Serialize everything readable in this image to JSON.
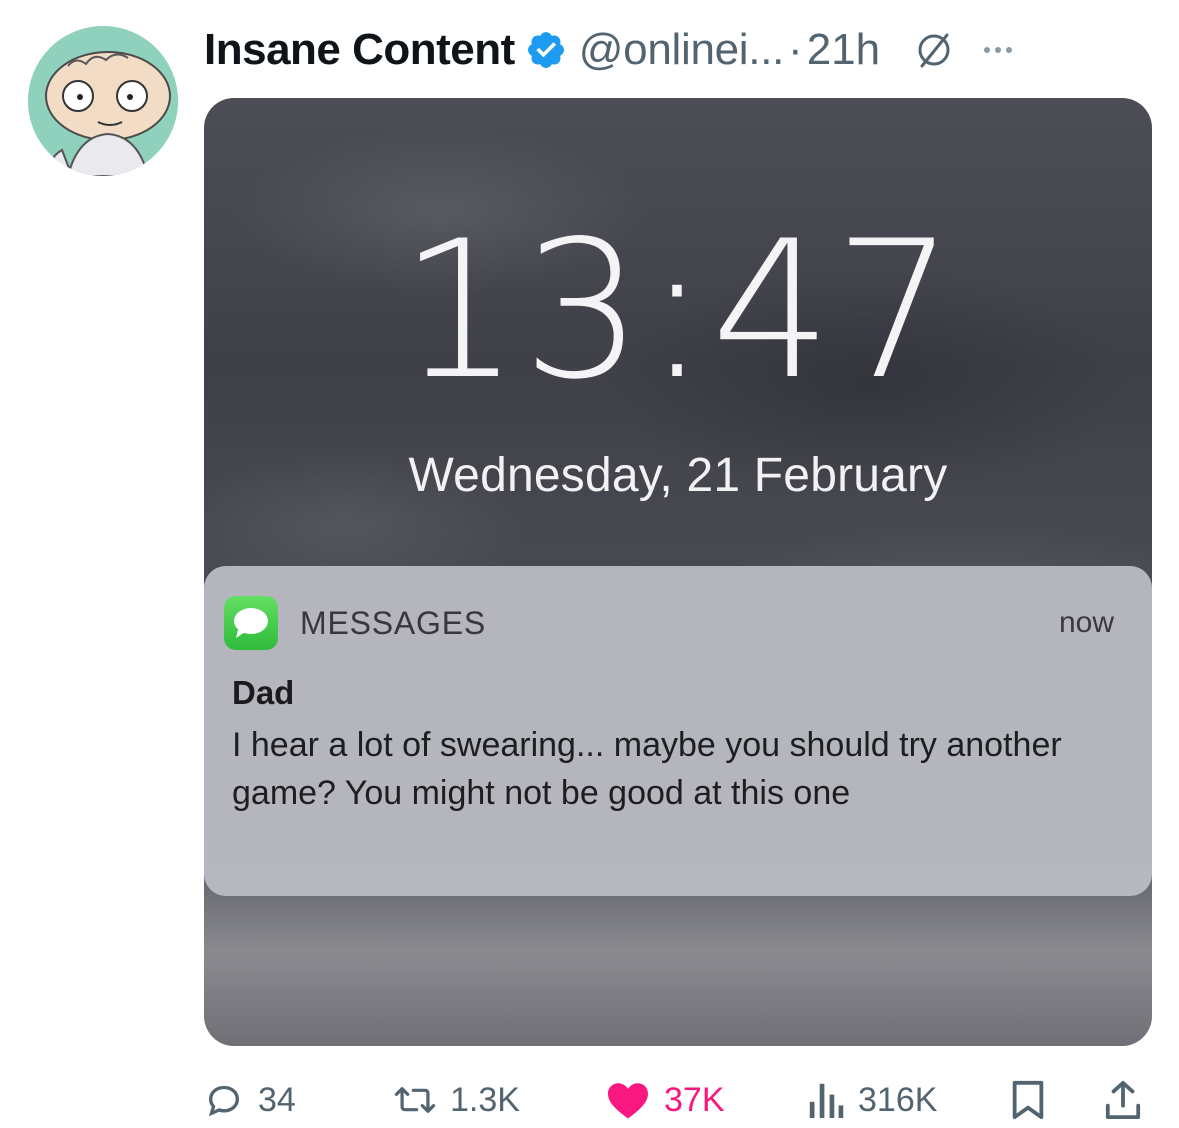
{
  "tweet": {
    "display_name": "Insane Content",
    "handle": "@onlinei...",
    "separator": "·",
    "time": "21h",
    "icons": {
      "verified": "verified-badge-icon",
      "grok": "grok-icon",
      "more": "more-options-icon"
    },
    "colors": {
      "verified": "#1d9bf0",
      "like": "#f91880",
      "muted": "#536471"
    }
  },
  "media": {
    "clock": "13:47",
    "date": "Wednesday, 21 February",
    "notification": {
      "app": "MESSAGES",
      "time": "now",
      "sender": "Dad",
      "body": "I hear a lot of swearing... maybe you should try another game? You might not be good at this one"
    }
  },
  "actions": {
    "reply": {
      "icon": "reply-icon",
      "count": "34"
    },
    "retweet": {
      "icon": "retweet-icon",
      "count": "1.3K"
    },
    "like": {
      "icon": "heart-icon",
      "count": "37K",
      "liked": true
    },
    "views": {
      "icon": "views-icon",
      "count": "316K"
    },
    "bookmark": {
      "icon": "bookmark-icon"
    },
    "share": {
      "icon": "share-icon"
    }
  }
}
